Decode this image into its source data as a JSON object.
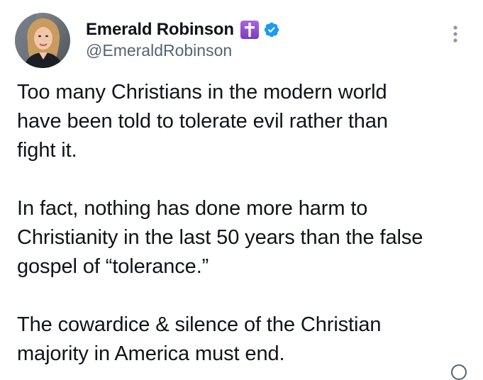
{
  "author": {
    "display_name": "Emerald Robinson",
    "handle": "@EmeraldRobinson",
    "avatar_icon": "profile-photo",
    "badges": [
      "latin-cross-icon",
      "verified-check-icon"
    ]
  },
  "menu": {
    "icon": "more-vertical-icon"
  },
  "tweet": {
    "paragraphs": [
      "Too many Christians in the modern world\nhave been told to tolerate evil rather than\nfight it.",
      "In fact, nothing has done more harm to\nChristianity in the last 50 years than the false\ngospel of “tolerance.”",
      "The cowardice & silence of the Christian\nmajority in America must end."
    ]
  },
  "colors": {
    "text_primary": "#0f1419",
    "text_secondary": "#536471",
    "verified_blue": "#1d9bf0",
    "cross_badge_purple": "#8e4fc9"
  }
}
